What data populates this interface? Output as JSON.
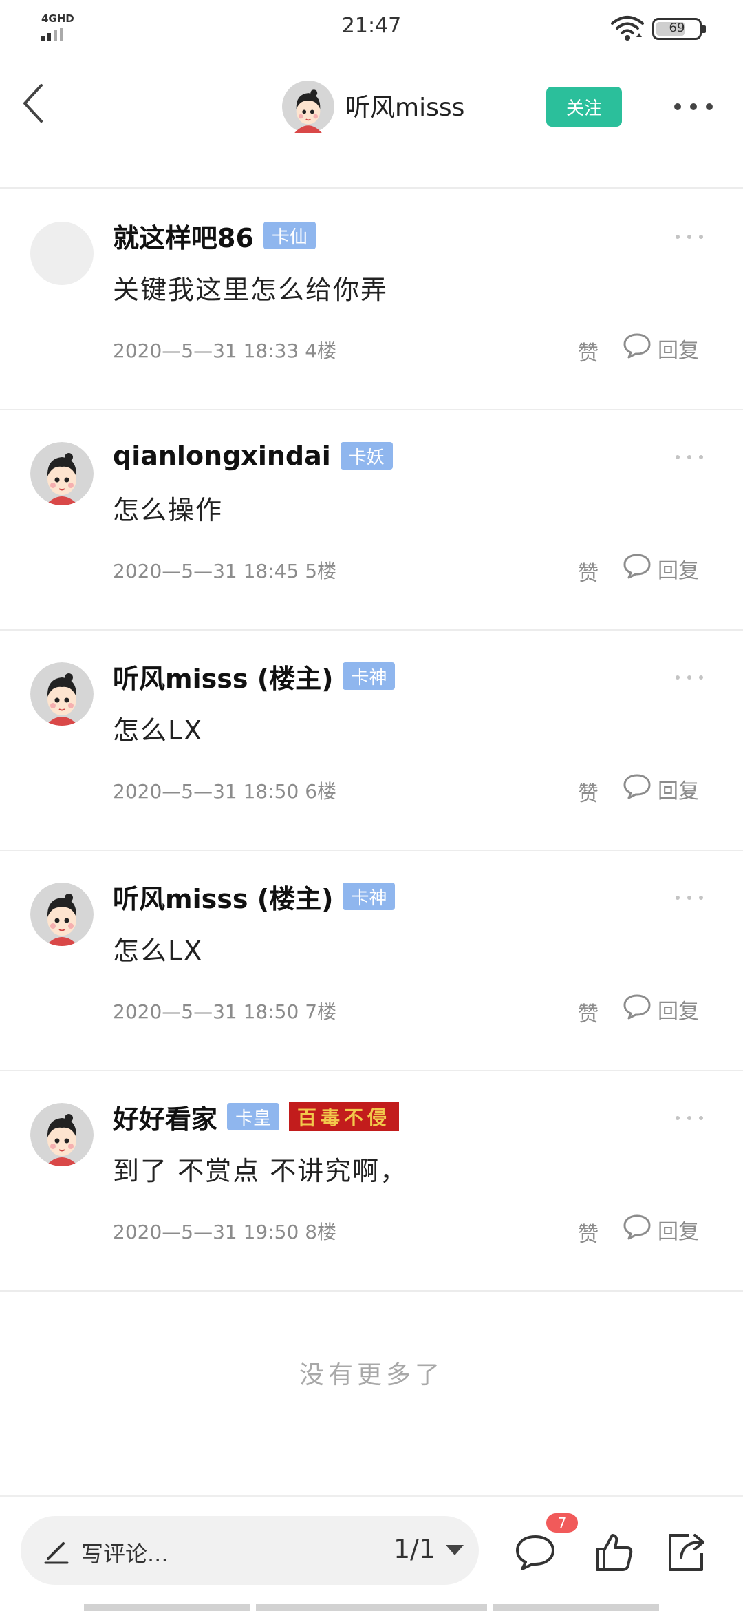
{
  "status_bar": {
    "network": "4GHD",
    "time": "21:47",
    "battery": "69"
  },
  "nav": {
    "username": "听风misss",
    "follow_label": "关注"
  },
  "comments": [
    {
      "name": "就这样吧86",
      "badge": "卡仙",
      "content": "关键我这里怎么给你弄",
      "meta": "2020—5—31 18:33  4楼",
      "like": "赞",
      "reply": "回复",
      "avatar": "empty"
    },
    {
      "name": "qianlongxindai",
      "badge": "卡妖",
      "content": "怎么操作",
      "meta": "2020—5—31 18:45  5楼",
      "like": "赞",
      "reply": "回复",
      "avatar": "girl"
    },
    {
      "name": "听风misss (楼主)",
      "badge": "卡神",
      "content": "怎么LX",
      "meta": "2020—5—31 18:50  6楼",
      "like": "赞",
      "reply": "回复",
      "avatar": "girl"
    },
    {
      "name": "听风misss (楼主)",
      "badge": "卡神",
      "content": "怎么LX",
      "meta": "2020—5—31 18:50  7楼",
      "like": "赞",
      "reply": "回复",
      "avatar": "girl"
    },
    {
      "name": "好好看家",
      "badge": "卡皇",
      "badge2": "百毒不侵",
      "content": "到了  不赏点   不讲究啊，",
      "meta": "2020—5—31 19:50  8楼",
      "like": "赞",
      "reply": "回复",
      "avatar": "girl"
    }
  ],
  "no_more": "没有更多了",
  "bottom_bar": {
    "input_placeholder": "写评论...",
    "page_indicator": "1/1",
    "comment_count": "7",
    "icons": [
      "pencil-icon",
      "comment-icon",
      "like-icon",
      "share-icon"
    ]
  },
  "colors": {
    "accent": "#2bbf9b",
    "badge": "#8fb6ee",
    "special_badge": "#c21c1c",
    "notification": "#f15a5a"
  }
}
